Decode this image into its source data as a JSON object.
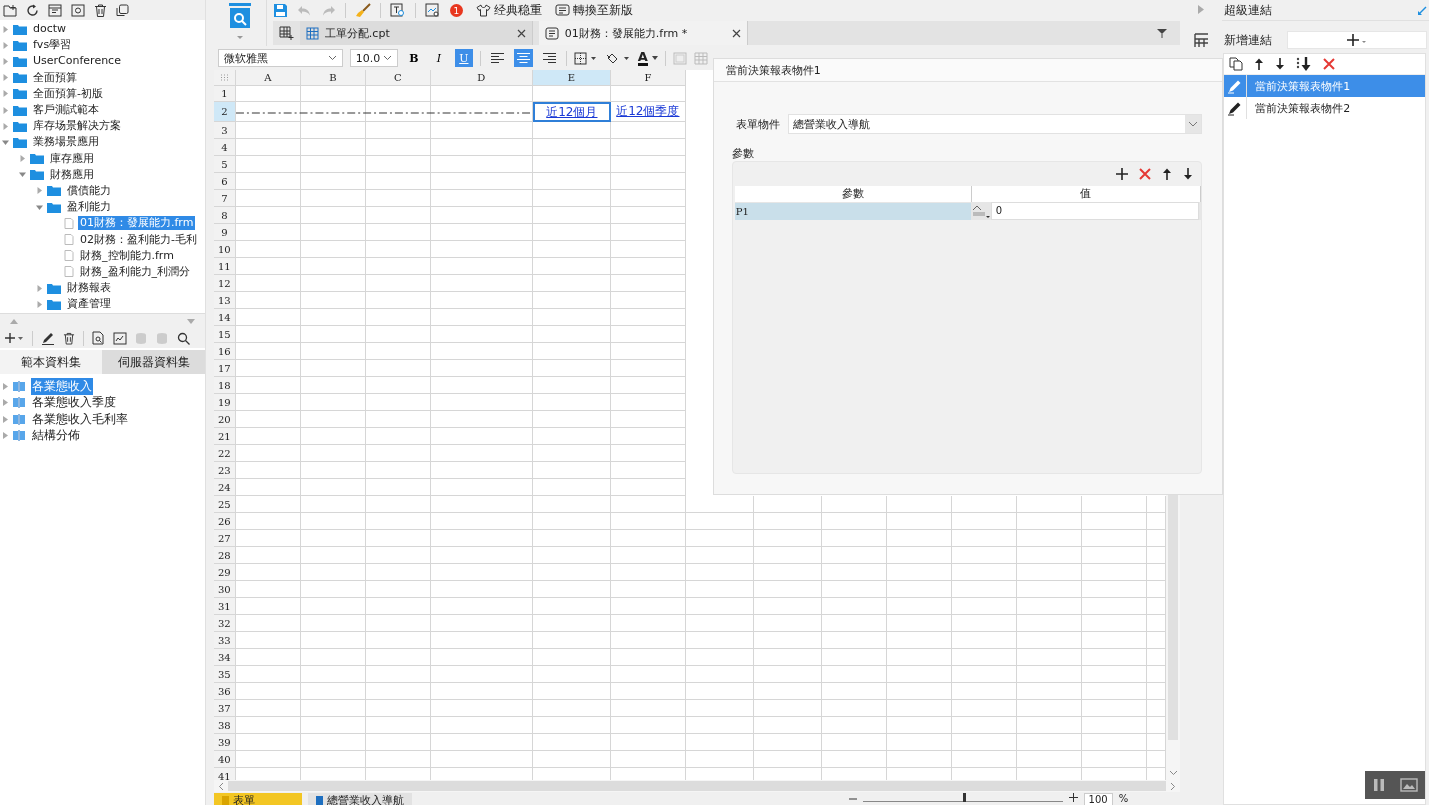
{
  "file_tree": [
    {
      "label": "doctw",
      "kind": "folder",
      "expanded": false,
      "selected": false
    },
    {
      "label": "fvs學習",
      "kind": "folder",
      "expanded": false,
      "selected": false
    },
    {
      "label": "UserConference",
      "kind": "folder",
      "expanded": false,
      "selected": false
    },
    {
      "label": "全面預算",
      "kind": "folder",
      "expanded": false,
      "selected": false
    },
    {
      "label": "全面預算-初版",
      "kind": "folder",
      "expanded": false,
      "selected": false
    },
    {
      "label": "客戶測試範本",
      "kind": "folder",
      "expanded": false,
      "selected": false
    },
    {
      "label": "库存场景解决方案",
      "kind": "folder",
      "expanded": false,
      "selected": false
    },
    {
      "label": "業務場景應用",
      "kind": "folder",
      "expanded": true,
      "selected": false,
      "children": [
        {
          "label": "庫存應用",
          "kind": "folder",
          "expanded": false,
          "selected": false
        },
        {
          "label": "財務應用",
          "kind": "folder",
          "expanded": true,
          "selected": false,
          "children": [
            {
              "label": "償債能力",
              "kind": "folder",
              "expanded": false,
              "selected": false
            },
            {
              "label": "盈利能力",
              "kind": "folder",
              "expanded": true,
              "selected": false,
              "children": [
                {
                  "label": "01財務：發展能力.frm",
                  "kind": "file",
                  "selected": true
                },
                {
                  "label": "02財務：盈利能力-毛利",
                  "kind": "file",
                  "selected": false
                },
                {
                  "label": "財務_控制能力.frm",
                  "kind": "file",
                  "selected": false
                },
                {
                  "label": "財務_盈利能力_利潤分",
                  "kind": "file",
                  "selected": false
                }
              ]
            },
            {
              "label": "財務報表",
              "kind": "folder",
              "expanded": false,
              "selected": false
            },
            {
              "label": "資產管理",
              "kind": "folder",
              "expanded": false,
              "selected": false
            }
          ]
        }
      ]
    }
  ],
  "dataset_tabs": [
    {
      "label": "範本資料集",
      "selected": true
    },
    {
      "label": "伺服器資料集",
      "selected": false
    }
  ],
  "datasets": [
    {
      "label": "各業態收入",
      "selected": true
    },
    {
      "label": "各業態收入季度",
      "selected": false
    },
    {
      "label": "各業態收入毛利率",
      "selected": false
    },
    {
      "label": "結構分佈",
      "selected": false
    }
  ],
  "toolbar": {
    "badge": "1",
    "buttons": [
      {
        "label": "经典稳重",
        "kind": "theme"
      },
      {
        "label": "轉換至新版",
        "kind": "convert"
      }
    ]
  },
  "editor_tabs": [
    {
      "label": "工單分配.cpt",
      "kind": "report",
      "selected": false
    },
    {
      "label": "01財務：發展能力.frm *",
      "kind": "form",
      "selected": true
    }
  ],
  "format_bar": {
    "font": "微软雅黑",
    "size": "10.0",
    "style_buttons": [
      {
        "label": "B",
        "selected": false
      },
      {
        "label": "I",
        "selected": false
      },
      {
        "label": "U",
        "selected": true
      }
    ],
    "align_buttons": [
      {
        "kind": "left",
        "selected": false
      },
      {
        "kind": "center",
        "selected": true
      },
      {
        "kind": "right",
        "selected": false
      }
    ],
    "font_color_label": "A"
  },
  "sheet": {
    "columns": [
      {
        "label": "A",
        "selected": false
      },
      {
        "label": "B",
        "selected": false
      },
      {
        "label": "C",
        "selected": false
      },
      {
        "label": "D",
        "selected": false
      },
      {
        "label": "E",
        "selected": true,
        "row_2": {
          "text": "近12個月",
          "selected": true
        }
      },
      {
        "label": "F",
        "selected": false,
        "row_2": {
          "text": "近12個季度",
          "selected": false
        }
      }
    ],
    "rows": [
      {
        "label": "1",
        "selected": false
      },
      {
        "label": "2",
        "selected": true
      },
      {
        "label": "3",
        "selected": false
      },
      {
        "label": "4",
        "selected": false
      },
      {
        "label": "5",
        "selected": false
      },
      {
        "label": "6",
        "selected": false
      },
      {
        "label": "7",
        "selected": false
      },
      {
        "label": "8",
        "selected": false
      },
      {
        "label": "9",
        "selected": false
      },
      {
        "label": "10",
        "selected": false
      },
      {
        "label": "11",
        "selected": false
      },
      {
        "label": "12",
        "selected": false
      },
      {
        "label": "13",
        "selected": false
      },
      {
        "label": "14",
        "selected": false
      },
      {
        "label": "15",
        "selected": false
      },
      {
        "label": "16",
        "selected": false
      },
      {
        "label": "17",
        "selected": false
      },
      {
        "label": "18",
        "selected": false
      },
      {
        "label": "19",
        "selected": false
      },
      {
        "label": "20",
        "selected": false
      },
      {
        "label": "21",
        "selected": false
      },
      {
        "label": "22",
        "selected": false
      },
      {
        "label": "23",
        "selected": false
      },
      {
        "label": "24",
        "selected": false
      },
      {
        "label": "25",
        "selected": false
      },
      {
        "label": "26",
        "selected": false
      },
      {
        "label": "27",
        "selected": false
      },
      {
        "label": "28",
        "selected": false
      },
      {
        "label": "29",
        "selected": false
      },
      {
        "label": "30",
        "selected": false
      },
      {
        "label": "31",
        "selected": false
      },
      {
        "label": "32",
        "selected": false
      },
      {
        "label": "33",
        "selected": false
      },
      {
        "label": "34",
        "selected": false
      },
      {
        "label": "35",
        "selected": false
      },
      {
        "label": "36",
        "selected": false
      },
      {
        "label": "37",
        "selected": false
      },
      {
        "label": "38",
        "selected": false
      },
      {
        "label": "39",
        "selected": false
      },
      {
        "label": "40",
        "selected": false
      },
      {
        "label": "41",
        "selected": false
      }
    ]
  },
  "sheet_tabs": [
    {
      "label": "表單",
      "selected": true
    },
    {
      "label": "總營業收入導航",
      "selected": false
    }
  ],
  "zoom": {
    "value": "100",
    "unit": "%",
    "level": 0.5
  },
  "dialog": {
    "title": "當前決策報表物件1",
    "form_object": {
      "label": "表單物件",
      "value": "總營業收入導航"
    },
    "params": {
      "title": "參數",
      "columns": [
        "參數",
        "值"
      ],
      "rows": [
        {
          "name": "P1",
          "value": "0",
          "selected": true
        }
      ]
    }
  },
  "hyperlink_panel": {
    "title": "超級連結",
    "add_label": "新增連結",
    "items": [
      {
        "label": "當前決策報表物件1",
        "selected": true
      },
      {
        "label": "當前決策報表物件2",
        "selected": false
      }
    ]
  }
}
